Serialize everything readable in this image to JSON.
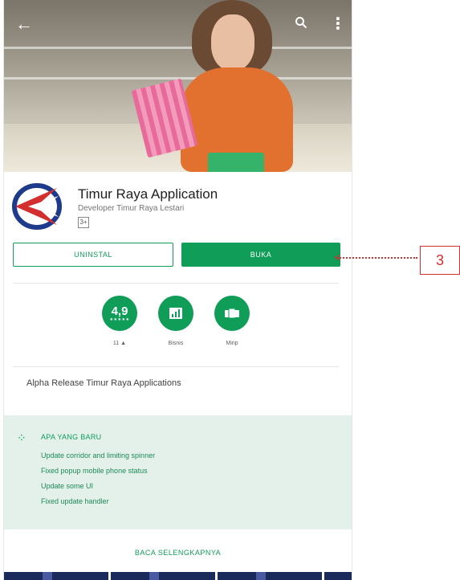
{
  "app": {
    "title": "Timur Raya Application",
    "developer": "Developer Timur Raya Lestari",
    "rated_badge": "3+",
    "description": "Alpha Release Timur Raya Applications"
  },
  "header_icons": {
    "back": "arrow-back-icon",
    "search": "search-icon",
    "menu": "more-vert-icon"
  },
  "buttons": {
    "uninstall": "UNINSTAL",
    "open": "BUKA"
  },
  "stats": [
    {
      "value": "4,9",
      "stars": "★★★★★",
      "label": "11 ▲"
    },
    {
      "icon": "chart-icon",
      "label": "Bisnis"
    },
    {
      "icon": "similar-apps-icon",
      "label": "Mirip"
    }
  ],
  "whats_new": {
    "title": "APA YANG BARU",
    "items": [
      "Update corridor and limiting spinner",
      "Fixed popup mobile phone status",
      "Update some UI",
      "Fixed update handler"
    ]
  },
  "read_more": "BACA SELENGKAPNYA",
  "annotation": {
    "number": "3"
  },
  "colors": {
    "accent": "#0f9d58",
    "annotation": "#d32f2f",
    "whats_new_bg": "#e3f1ea"
  }
}
